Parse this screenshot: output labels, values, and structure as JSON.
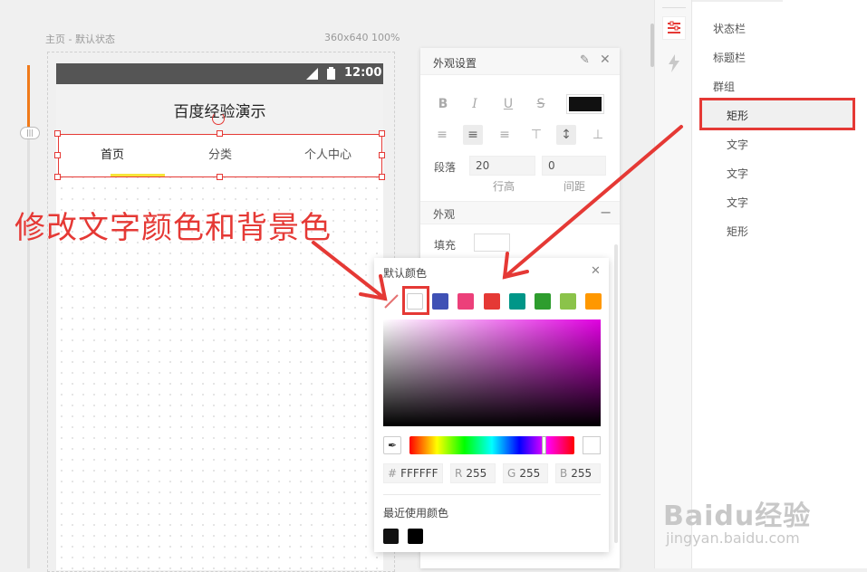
{
  "canvas": {
    "page_label": "主页 - 默认状态",
    "size_label": "360x640 100%"
  },
  "phone": {
    "status_time": "12:00",
    "title": "百度经验演示",
    "tabs": [
      {
        "label": "首页"
      },
      {
        "label": "分类"
      },
      {
        "label": "个人中心"
      }
    ]
  },
  "annotation": {
    "text": "修改文字颜色和背景色"
  },
  "appearance_panel": {
    "title": "外观设置",
    "format_buttons": [
      "B",
      "I",
      "U",
      "S"
    ],
    "text_color": "#111111",
    "paragraph_label": "段落",
    "line_height_value": "20",
    "letter_spacing_value": "0",
    "line_height_label": "行高",
    "spacing_label": "间距",
    "section_label": "外观",
    "fill_label": "填充"
  },
  "color_popup": {
    "title": "默认颜色",
    "swatches": [
      "none",
      "#ffffff",
      "#3f51b5",
      "#ec407a",
      "#e53935",
      "#009688",
      "#2e9d2e",
      "#8bc34a",
      "#ff9800"
    ],
    "hex_label": "#",
    "hex_value": "FFFFFF",
    "r_label": "R",
    "r_value": "255",
    "g_label": "G",
    "g_value": "255",
    "b_label": "B",
    "b_value": "255",
    "recent_label": "最近使用颜色",
    "recent_colors": [
      "#111111",
      "#000000"
    ]
  },
  "layers": {
    "items": [
      {
        "label": "状态栏"
      },
      {
        "label": "标题栏"
      },
      {
        "label": "群组"
      },
      {
        "label": "矩形"
      },
      {
        "label": "文字"
      },
      {
        "label": "文字"
      },
      {
        "label": "文字"
      },
      {
        "label": "矩形"
      }
    ]
  },
  "watermark": {
    "brand": "Baidu经验",
    "url": "jingyan.baidu.com"
  }
}
